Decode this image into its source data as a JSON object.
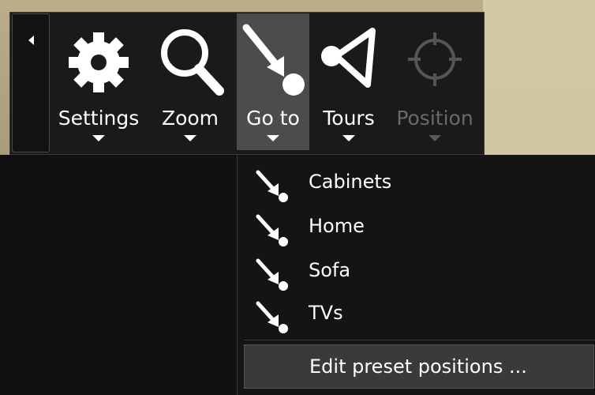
{
  "toolbar": {
    "collapse_icon": "collapse-left-arrow",
    "tools": [
      {
        "label": "Settings",
        "icon": "gear-icon",
        "state": "normal"
      },
      {
        "label": "Zoom",
        "icon": "magnifier-icon",
        "state": "normal"
      },
      {
        "label": "Go to",
        "icon": "goto-arrow-icon",
        "state": "active"
      },
      {
        "label": "Tours",
        "icon": "tours-icon",
        "state": "normal"
      },
      {
        "label": "Position",
        "icon": "crosshair-icon",
        "state": "disabled"
      }
    ]
  },
  "goto_menu": {
    "items": [
      {
        "label": "Cabinets",
        "icon": "goto-arrow-icon"
      },
      {
        "label": "Home",
        "icon": "goto-arrow-icon"
      },
      {
        "label": "Sofa",
        "icon": "goto-arrow-icon"
      },
      {
        "label": "TVs",
        "icon": "goto-arrow-icon"
      }
    ],
    "edit_label": "Edit preset positions ..."
  },
  "colors": {
    "toolbar_bg": "#1a1a1a",
    "active_tool_bg": "#4c4c4c",
    "disabled_text": "#6a6a6a",
    "menu_bg": "#141414"
  }
}
